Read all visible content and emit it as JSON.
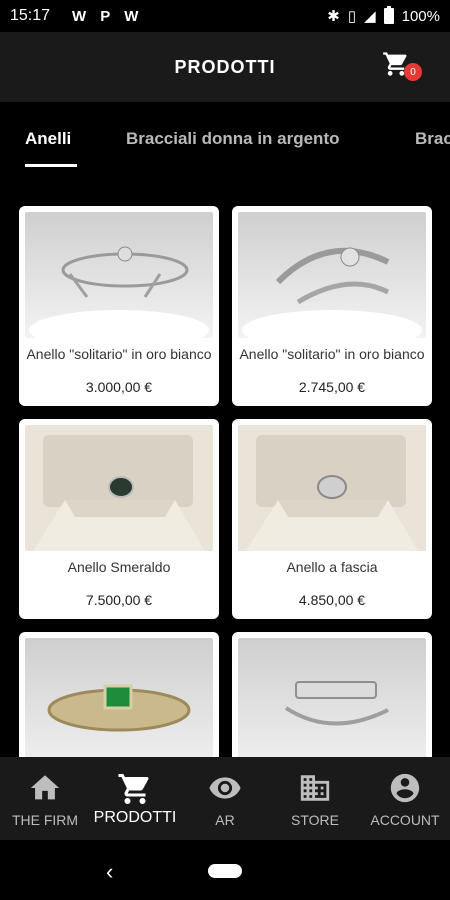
{
  "status_bar": {
    "time": "15:17",
    "app_icons": [
      "W",
      "P",
      "W"
    ],
    "battery": "100%"
  },
  "header": {
    "title": "PRODOTTI",
    "cart_count": "0"
  },
  "tabs": [
    {
      "label": "Anelli",
      "active": true
    },
    {
      "label": "Bracciali donna in argento",
      "active": false
    },
    {
      "label": "Brac",
      "active": false
    }
  ],
  "products": [
    {
      "name": "Anello \"solitario\" in oro bianco",
      "price": "3.000,00 €"
    },
    {
      "name": "Anello \"solitario\" in oro bianco",
      "price": "2.745,00 €"
    },
    {
      "name": "Anello Smeraldo",
      "price": "7.500,00 €"
    },
    {
      "name": "Anello a fascia",
      "price": "4.850,00 €"
    },
    {
      "name": "",
      "price": ""
    },
    {
      "name": "",
      "price": ""
    }
  ],
  "bottom_nav": [
    {
      "label": "THE FIRM",
      "icon": "home-icon",
      "active": false
    },
    {
      "label": "PRODOTTI",
      "icon": "cart-icon",
      "active": true
    },
    {
      "label": "AR",
      "icon": "eye-icon",
      "active": false
    },
    {
      "label": "STORE",
      "icon": "building-icon",
      "active": false
    },
    {
      "label": "ACCOUNT",
      "icon": "account-icon",
      "active": false
    }
  ],
  "colors": {
    "header_bg": "#1a1a1a",
    "badge": "#e53935",
    "page_bg": "#000000"
  }
}
